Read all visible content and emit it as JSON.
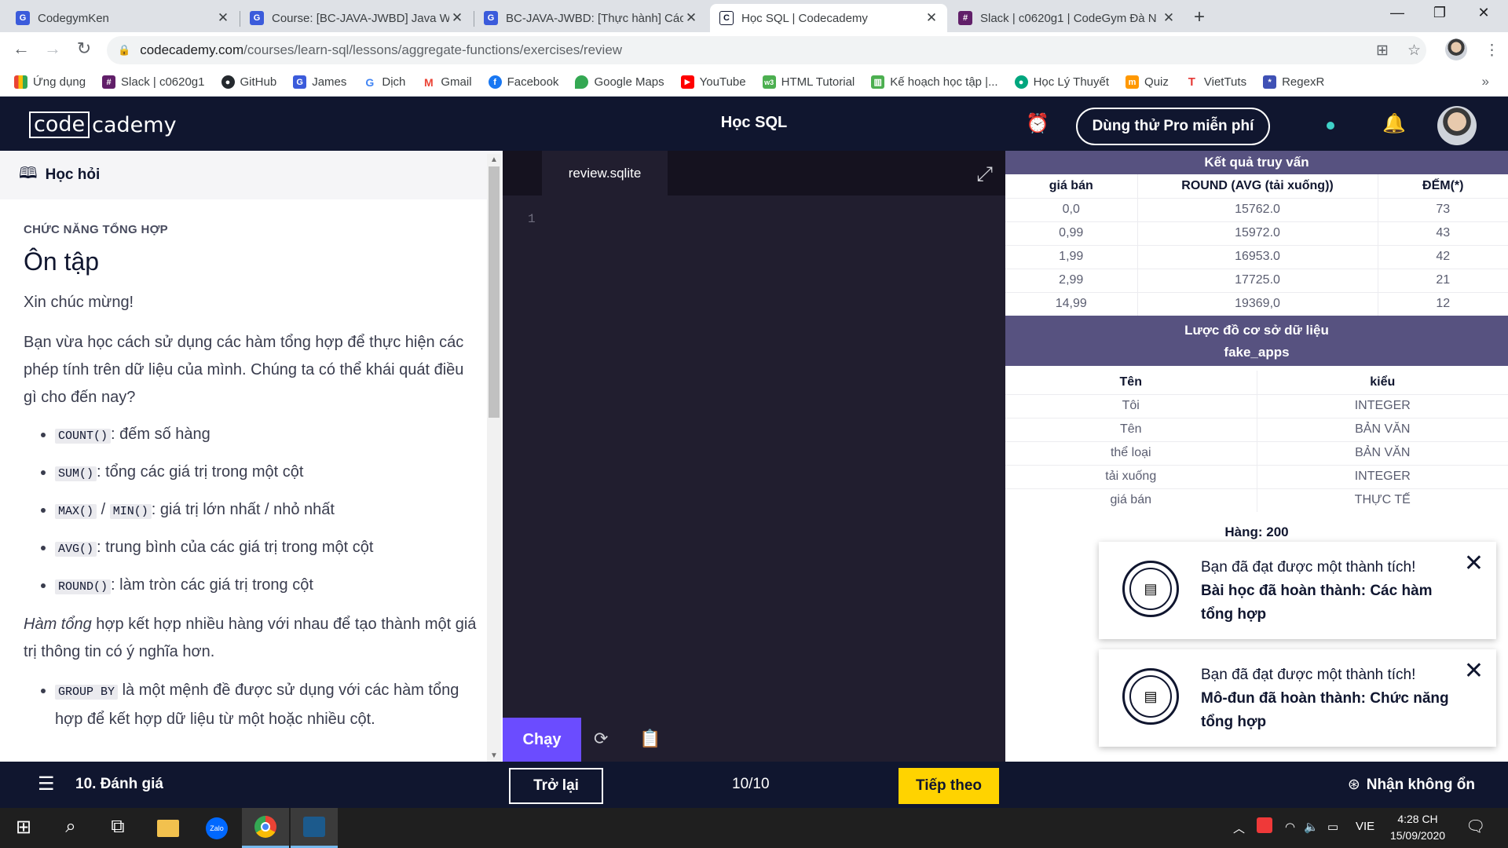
{
  "browser": {
    "tabs": [
      {
        "title": "CodegymKen",
        "fav": "G",
        "color": "#3b5bdb"
      },
      {
        "title": "Course: [BC-JAVA-JWBD] Java We",
        "fav": "G",
        "color": "#3b5bdb"
      },
      {
        "title": "BC-JAVA-JWBD: [Thực hành] Các",
        "fav": "G",
        "color": "#3b5bdb"
      },
      {
        "title": "Học SQL | Codecademy",
        "fav": "C",
        "color": "#10162f"
      },
      {
        "title": "Slack | c0620g1 | CodeGym Đà N",
        "fav": "#",
        "color": "#611f69"
      }
    ],
    "url_host": "codecademy.com",
    "url_path": "/courses/learn-sql/lessons/aggregate-functions/exercises/review",
    "bookmarks": [
      {
        "label": "Ứng dụng",
        "color": "#ea4335"
      },
      {
        "label": "Slack | c0620g1",
        "color": "#611f69"
      },
      {
        "label": "GitHub",
        "color": "#24292e"
      },
      {
        "label": "James",
        "color": "#3b5bdb"
      },
      {
        "label": "Dịch",
        "color": "#4285f4"
      },
      {
        "label": "Gmail",
        "color": "#ea4335"
      },
      {
        "label": "Facebook",
        "color": "#1877f2"
      },
      {
        "label": "Google Maps",
        "color": "#34a853"
      },
      {
        "label": "YouTube",
        "color": "#ff0000"
      },
      {
        "label": "HTML Tutorial",
        "color": "#4caf50"
      },
      {
        "label": "Kế hoạch học tập |...",
        "color": "#0079bf"
      },
      {
        "label": "Học Lý Thuyết",
        "color": "#00a67e"
      },
      {
        "label": "Quiz",
        "color": "#ff9800"
      },
      {
        "label": "VietTuts",
        "color": "#e53935"
      },
      {
        "label": "RegexR",
        "color": "#3f51b5"
      }
    ]
  },
  "header": {
    "logo_box": "code",
    "logo_rest": "cademy",
    "title": "Học SQL",
    "pro_button": "Dùng thử Pro miễn phí"
  },
  "learn": {
    "tab_label": "Học hỏi",
    "kicker": "CHỨC NĂNG TỔNG HỢP",
    "heading": "Ôn tập",
    "p1": "Xin chúc mừng!",
    "p2": "Bạn vừa học cách sử dụng các hàm tổng hợp để thực hiện các phép tính trên dữ liệu của mình. Chúng ta có thể khái quát điều gì cho đến nay?",
    "items": [
      {
        "codes": [
          "COUNT()"
        ],
        "sep": "",
        "text": ": đếm số hàng"
      },
      {
        "codes": [
          "SUM()"
        ],
        "sep": "",
        "text": ": tổng các giá trị trong một cột"
      },
      {
        "codes": [
          "MAX()",
          "MIN()"
        ],
        "sep": " / ",
        "text": ": giá trị lớn nhất / nhỏ nhất"
      },
      {
        "codes": [
          "AVG()"
        ],
        "sep": "",
        "text": ": trung bình của các giá trị trong một cột"
      },
      {
        "codes": [
          "ROUND()"
        ],
        "sep": "",
        "text": ": làm tròn các giá trị trong cột"
      }
    ],
    "p3_em": "Hàm tổng",
    "p3_rest": " hợp kết hợp nhiều hàng với nhau để tạo thành một giá trị thông tin có ý nghĩa hơn.",
    "groupby_code": "GROUP BY",
    "groupby_text": " là một mệnh đề được sử dụng với các hàm tổng hợp để kết hợp dữ liệu từ một hoặc nhiều cột."
  },
  "editor": {
    "filename": "review.sqlite",
    "line_number": "1",
    "run_label": "Chạy"
  },
  "results": {
    "title": "Kết quả truy vấn",
    "columns": [
      "giá bán",
      "ROUND (AVG (tải xuống))",
      "ĐẾM(*)"
    ],
    "rows": [
      [
        "0,0",
        "15762.0",
        "73"
      ],
      [
        "0,99",
        "15972.0",
        "43"
      ],
      [
        "1,99",
        "16953.0",
        "42"
      ],
      [
        "2,99",
        "17725.0",
        "21"
      ],
      [
        "14,99",
        "19369,0",
        "12"
      ]
    ],
    "schema_title": "Lược đồ cơ sở dữ liệu",
    "table_name": "fake_apps",
    "schema_columns": [
      "Tên",
      "kiểu"
    ],
    "schema_rows": [
      [
        "Tôi",
        "INTEGER"
      ],
      [
        "Tên",
        "BẢN VĂN"
      ],
      [
        "thể loại",
        "BẢN VĂN"
      ],
      [
        "tải xuống",
        "INTEGER"
      ],
      [
        "giá bán",
        "THỰC TẾ"
      ]
    ],
    "rows_label": "Hàng: 200"
  },
  "toasts": [
    {
      "line1": "Bạn đã đạt được một thành tích!",
      "line2": "Bài học đã hoàn thành: Các hàm tổng hợp"
    },
    {
      "line1": "Bạn đã đạt được một thành tích!",
      "line2": "Mô-đun đã hoàn thành: Chức năng tổng hợp"
    }
  ],
  "footer": {
    "lesson": "10. Đánh giá",
    "back": "Trở lại",
    "progress": "10/10",
    "next": "Tiếp theo",
    "help": "Nhận không ổn"
  },
  "taskbar": {
    "lang": "VIE",
    "time": "4:28 CH",
    "date": "15/09/2020"
  }
}
